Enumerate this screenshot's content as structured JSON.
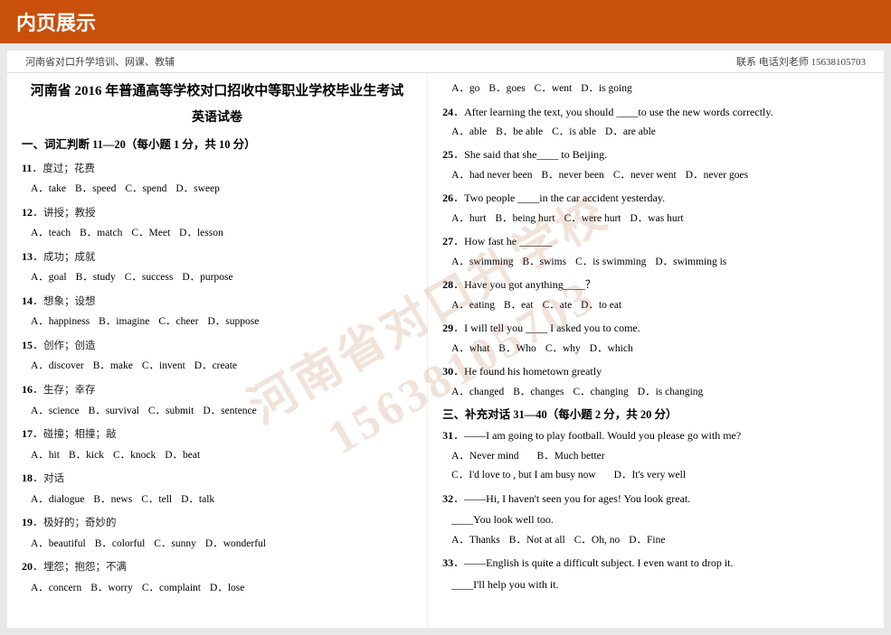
{
  "header": {
    "title": "内页展示"
  },
  "topbar": {
    "left": "河南省对口升学培训、网课、教辅",
    "right": "联系 电话刘老师 15638105703"
  },
  "doc": {
    "title": "河南省 2016 年普通高等学校对口招收中等职业学校毕业生考试",
    "subtitle": "英语试卷",
    "section1": {
      "title": "一、词汇判断 11—20（每小题 1 分，共 10 分）",
      "questions": [
        {
          "num": "11",
          "hint": "度过；花费",
          "options": [
            "A．take",
            "B．speed",
            "C．spend",
            "D．sweep"
          ]
        },
        {
          "num": "12",
          "hint": "讲授；教授",
          "options": [
            "A．teach",
            "B．match",
            "C．Meet",
            "D．lesson"
          ]
        },
        {
          "num": "13",
          "hint": "成功；成就",
          "options": [
            "A．goal",
            "B．study",
            "C．success",
            "D．purpose"
          ]
        },
        {
          "num": "14",
          "hint": "想象；设想",
          "options": [
            "A．happiness",
            "B．imagine",
            "C．cheer",
            "D．suppose"
          ]
        },
        {
          "num": "15",
          "hint": "创作；创造",
          "options": [
            "A．discover",
            "B．make",
            "C．invent",
            "D．create"
          ]
        },
        {
          "num": "16",
          "hint": "生存；幸存",
          "options": [
            "A．science",
            "B．survival",
            "C．submit",
            "D．sentence"
          ]
        },
        {
          "num": "17",
          "hint": "碰撞；相撞；敲",
          "options": [
            "A．hit",
            "B．kick",
            "C．knock",
            "D．beat"
          ]
        },
        {
          "num": "18",
          "hint": "对话",
          "options": [
            "A．dialogue",
            "B．news",
            "C．tell",
            "D．talk"
          ]
        },
        {
          "num": "19",
          "hint": "极好的；奇妙的",
          "options": [
            "A．beautiful",
            "B．colorful",
            "C．sunny",
            "D．wonderful"
          ]
        },
        {
          "num": "20",
          "hint": "埋怨；抱怨；不满",
          "options": [
            "A．concern",
            "B．worry",
            "C．complaint",
            "D．lose"
          ]
        }
      ]
    },
    "section2_right": {
      "questions": [
        {
          "num": "",
          "text": "",
          "options": [
            "A．go",
            "B．goes",
            "C．went",
            "D．is going"
          ]
        },
        {
          "num": "24",
          "text": "After learning the text, you should ____to use the new words correctly.",
          "options": [
            "A．able",
            "B．be able",
            "C．is able",
            "D．are able"
          ]
        },
        {
          "num": "25",
          "text": "She said that she____ to Beijing.",
          "options": [
            "A．had never been",
            "B．never been",
            "C．never went",
            "D．never goes"
          ]
        },
        {
          "num": "26",
          "text": "Two people ____in the car accident yesterday.",
          "options": [
            "A．hurt",
            "B．being hurt",
            "C．were hurt",
            "D．was hurt"
          ]
        },
        {
          "num": "27",
          "text": "How fast he ______",
          "options": [
            "A．swimming",
            "B．swims",
            "C．is swimming",
            "D．swimming is"
          ]
        },
        {
          "num": "28",
          "text": "Have you got anything____？",
          "options": [
            "A．eating",
            "B．eat",
            "C．ate",
            "D．to eat"
          ]
        },
        {
          "num": "29",
          "text": "I will tell you ____ I asked you to come.",
          "options": [
            "A．what",
            "B．Who",
            "C．why",
            "D．which"
          ]
        },
        {
          "num": "30",
          "text": "He found his hometown greatly",
          "options": [
            "A．changed",
            "B．changes",
            "C．changing",
            "D．is changing"
          ]
        }
      ]
    },
    "section3": {
      "title": "三、补充对话 31—40（每小题 2 分，共 20 分）",
      "questions": [
        {
          "num": "31",
          "text": "——I am going to play football. Would you please go with me?",
          "blank": "",
          "options": [
            "A．Never mind",
            "B．Much better",
            "C．I'd love to , but I am busy now",
            "D．It's very well"
          ]
        },
        {
          "num": "32",
          "text": "——Hi, I haven't seen you for ages! You look great.",
          "subtext": "____You look well too.",
          "options": [
            "A．Thanks",
            "B．Not at all",
            "C．Oh, no",
            "D．Fine"
          ]
        },
        {
          "num": "33",
          "text": "——English is quite a difficult subject. I even want to drop it.",
          "subtext": "____I'll help you with it."
        }
      ]
    }
  },
  "watermark": {
    "line1": "河南省对口升学校",
    "line2": "15638105703"
  }
}
